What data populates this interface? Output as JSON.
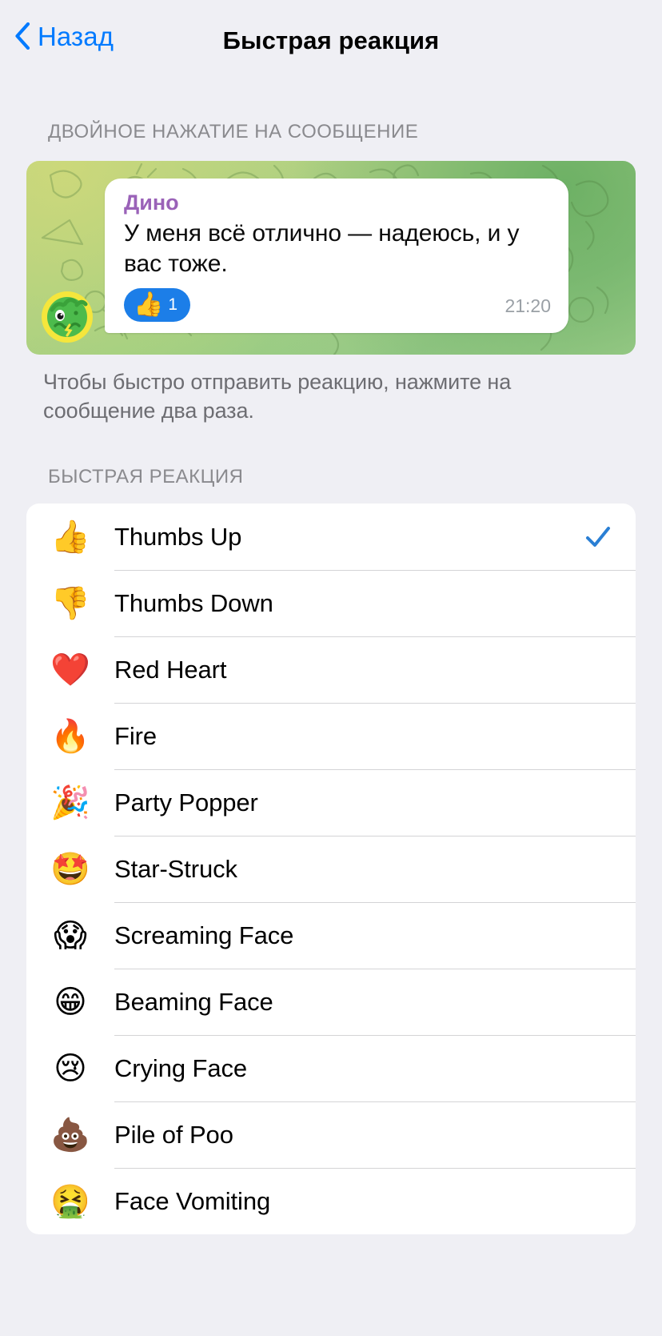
{
  "navbar": {
    "back_label": "Назад",
    "back_icon": "chevron-left-icon",
    "title": "Быстрая реакция"
  },
  "double_tap_section": {
    "header": "ДВОЙНОЕ НАЖАТИЕ НА СООБЩЕНИЕ",
    "footer_note": "Чтобы быстро отправить реакцию, нажмите на сообщение два раза.",
    "preview": {
      "sender_name": "Дино",
      "sender_name_color": "#9a62b8",
      "message_text": "У меня всё отлично — надеюсь, и у вас тоже.",
      "timestamp": "21:20",
      "avatar_icon": "dinosaur-avatar-icon",
      "reaction": {
        "emoji": "👍",
        "emoji_name": "thumbs-up-icon",
        "count": "1",
        "pill_color": "#1c7ee8"
      }
    }
  },
  "quick_reaction_section": {
    "header": "БЫСТРАЯ РЕАКЦИЯ",
    "selected": "Thumbs Up",
    "check_color": "#2a7fd4",
    "items": [
      {
        "emoji": "👍",
        "icon": "thumbs-up-icon",
        "label": "Thumbs Up",
        "selected": true
      },
      {
        "emoji": "👎",
        "icon": "thumbs-down-icon",
        "label": "Thumbs Down",
        "selected": false
      },
      {
        "emoji": "❤️",
        "icon": "red-heart-icon",
        "label": "Red Heart",
        "selected": false
      },
      {
        "emoji": "🔥",
        "icon": "fire-icon",
        "label": "Fire",
        "selected": false
      },
      {
        "emoji": "🎉",
        "icon": "party-popper-icon",
        "label": "Party Popper",
        "selected": false
      },
      {
        "emoji": "🤩",
        "icon": "star-struck-icon",
        "label": "Star-Struck",
        "selected": false
      },
      {
        "emoji": "😱",
        "icon": "screaming-face-icon",
        "label": "Screaming Face",
        "selected": false
      },
      {
        "emoji": "😁",
        "icon": "beaming-face-icon",
        "label": "Beaming Face",
        "selected": false
      },
      {
        "emoji": "😢",
        "icon": "crying-face-icon",
        "label": "Crying Face",
        "selected": false
      },
      {
        "emoji": "💩",
        "icon": "pile-of-poo-icon",
        "label": "Pile of Poo",
        "selected": false
      },
      {
        "emoji": "🤮",
        "icon": "face-vomiting-icon",
        "label": "Face Vomiting",
        "selected": false
      }
    ]
  },
  "theme": {
    "page_background": "#efeff4",
    "card_background": "#ffffff",
    "accent_blue": "#007aff",
    "separator": "#d4d4d6",
    "secondary_text": "#8a8a8e"
  }
}
